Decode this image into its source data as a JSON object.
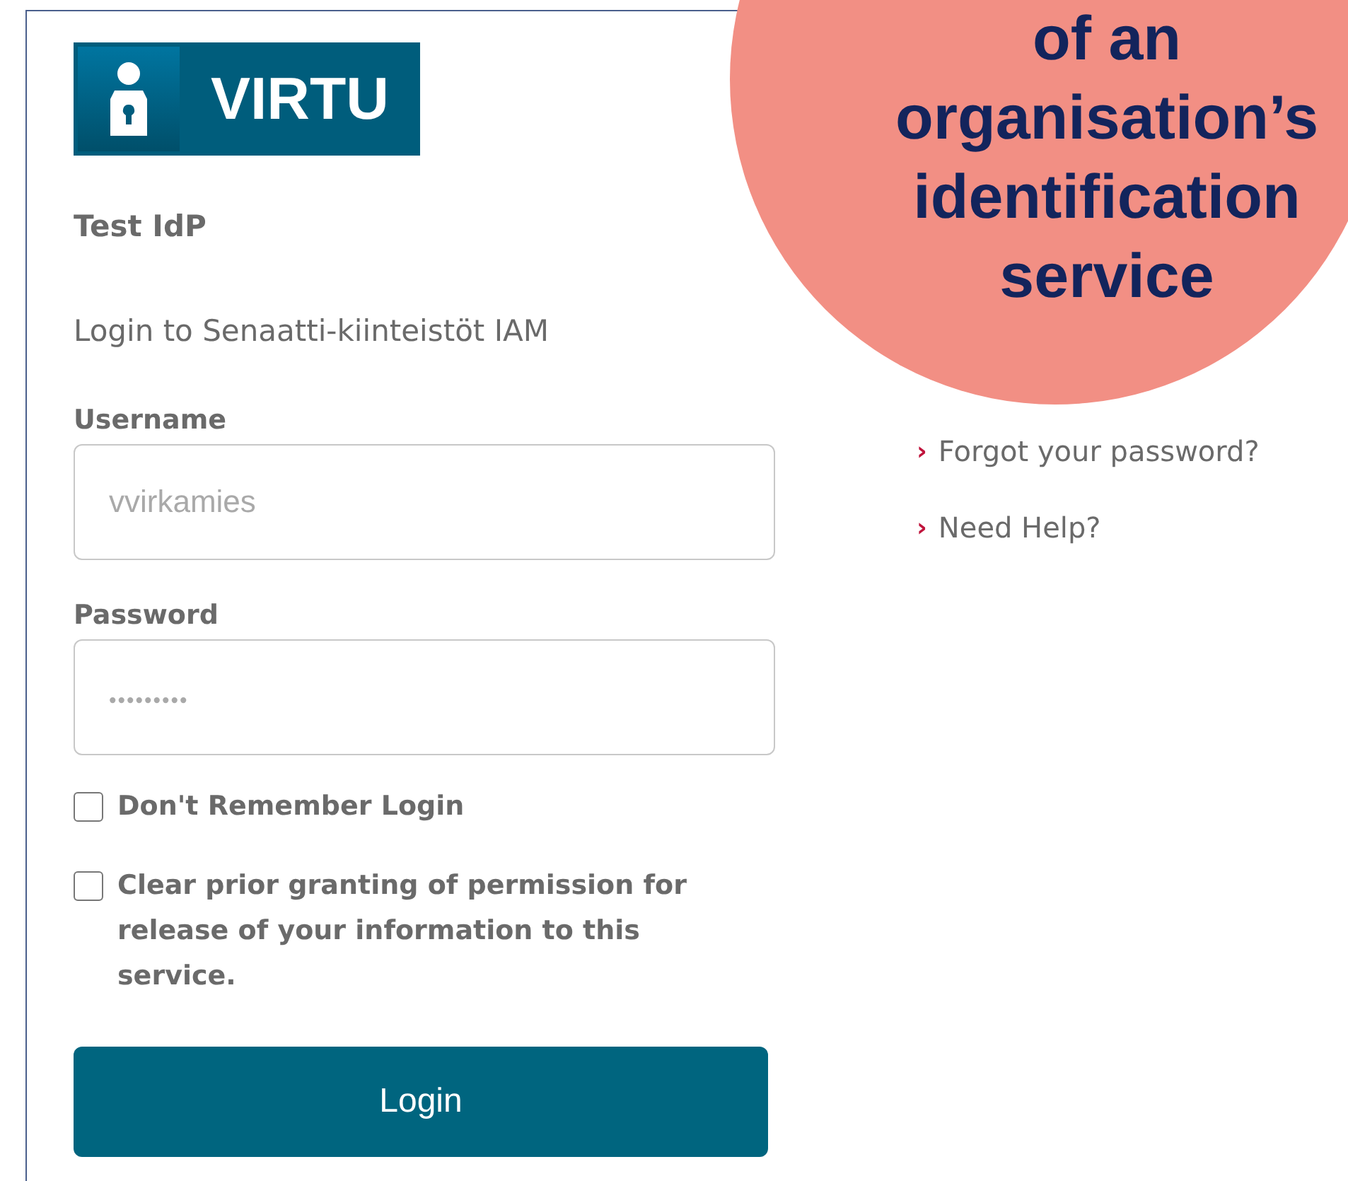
{
  "logo": {
    "text": "VIRTU"
  },
  "idp_name": "Test IdP",
  "heading": "Login to Senaatti-kiinteistöt IAM",
  "fields": [
    {
      "label": "Username",
      "placeholder": "vvirkamies",
      "kind": "text"
    },
    {
      "label": "Password",
      "placeholder": "•••••••••",
      "kind": "password"
    }
  ],
  "options": [
    {
      "label": "Don't Remember Login",
      "checked": false
    },
    {
      "label": "Clear prior granting of permission for release of your information to this service.",
      "checked": false
    }
  ],
  "login_button": "Login",
  "links": [
    {
      "marker": "›",
      "label": "Forgot your password?"
    },
    {
      "marker": "›",
      "label": "Need Help?"
    }
  ],
  "callout": {
    "lines": [
      "of an",
      "organisation’s",
      "identification",
      "service"
    ]
  }
}
